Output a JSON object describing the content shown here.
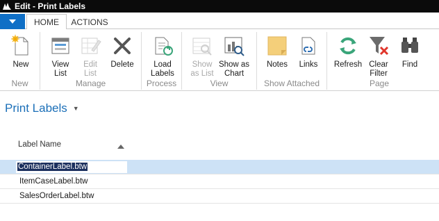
{
  "window": {
    "title": "Edit - Print Labels"
  },
  "tabs": [
    {
      "label": "HOME"
    },
    {
      "label": "ACTIONS"
    }
  ],
  "ribbon": {
    "groups": [
      {
        "label": "New",
        "buttons": [
          {
            "label": "New",
            "icon": "new-document-icon"
          }
        ]
      },
      {
        "label": "Manage",
        "buttons": [
          {
            "label": "View List",
            "icon": "view-list-icon"
          },
          {
            "label": "Edit List",
            "icon": "edit-list-icon",
            "disabled": true
          },
          {
            "label": "Delete",
            "icon": "delete-x-icon"
          }
        ]
      },
      {
        "label": "Process",
        "buttons": [
          {
            "label": "Load Labels",
            "icon": "load-labels-icon"
          }
        ]
      },
      {
        "label": "View",
        "buttons": [
          {
            "label": "Show as List",
            "icon": "show-as-list-icon",
            "disabled": true
          },
          {
            "label": "Show as Chart",
            "icon": "show-as-chart-icon"
          }
        ]
      },
      {
        "label": "Show Attached",
        "buttons": [
          {
            "label": "Notes",
            "icon": "notes-icon"
          },
          {
            "label": "Links",
            "icon": "links-icon"
          }
        ]
      },
      {
        "label": "Page",
        "buttons": [
          {
            "label": "Refresh",
            "icon": "refresh-icon"
          },
          {
            "label": "Clear Filter",
            "icon": "clear-filter-icon"
          },
          {
            "label": "Find",
            "icon": "find-binoculars-icon"
          }
        ]
      }
    ]
  },
  "page": {
    "title": "Print Labels",
    "column_header": "Label Name",
    "rows": [
      "ContainerLabel.btw",
      "ItemCaseLabel.btw",
      "SalesOrderLabel.btw"
    ],
    "selected_row": 0
  },
  "colors": {
    "accent": "#1b6fb8",
    "app_button": "#0f6fc6",
    "selection": "#cde2f6"
  }
}
